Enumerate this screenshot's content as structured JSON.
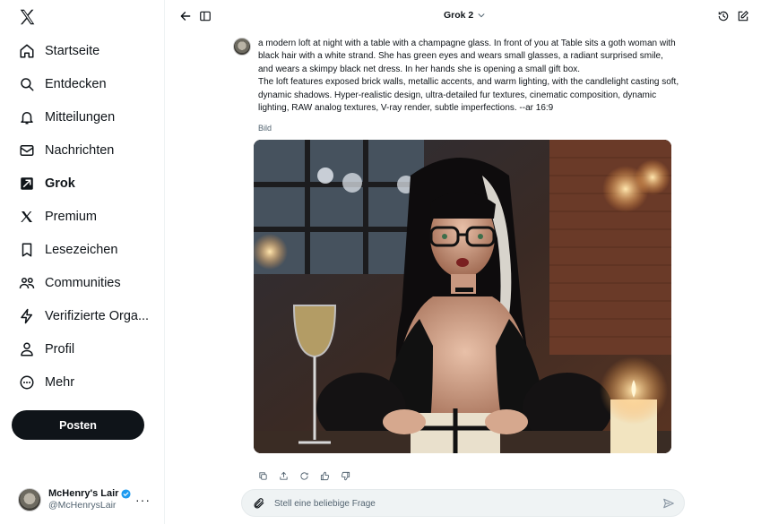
{
  "sidebar": {
    "logo_icon": "x-logo-icon",
    "items": [
      {
        "label": "Startseite",
        "icon": "home-icon"
      },
      {
        "label": "Entdecken",
        "icon": "search-icon"
      },
      {
        "label": "Mitteilungen",
        "icon": "bell-icon"
      },
      {
        "label": "Nachrichten",
        "icon": "mail-icon"
      },
      {
        "label": "Grok",
        "icon": "grok-icon",
        "active": true
      },
      {
        "label": "Premium",
        "icon": "x-premium-icon"
      },
      {
        "label": "Lesezeichen",
        "icon": "bookmark-icon"
      },
      {
        "label": "Communities",
        "icon": "people-icon"
      },
      {
        "label": "Verifizierte Orga...",
        "icon": "lightning-icon"
      },
      {
        "label": "Profil",
        "icon": "person-icon"
      },
      {
        "label": "Mehr",
        "icon": "more-circle-icon"
      }
    ],
    "post_label": "Posten"
  },
  "account": {
    "name": "McHenry's Lair",
    "handle": "@McHenrysLair",
    "verified_color": "#1d9bf0",
    "more": "···"
  },
  "topbar": {
    "model": "Grok 2"
  },
  "chat": {
    "prompt_line1": "a modern loft at night with a table with a champagne glass. In front of you at Table sits a goth woman with black hair with a white strand. She has green eyes and wears small glasses, a radiant surprised smile, and wears a skimpy  black  net dress. In her hands she is  opening a  small gift box.",
    "prompt_line2": "The loft features exposed brick walls, metallic accents, and warm lighting, with the candlelight casting soft, dynamic shadows. Hyper-realistic design, ultra-detailed fur textures, cinematic composition, dynamic lighting, RAW analog textures, V-ray render, subtle imperfections. --ar 16:9",
    "image_label": "Bild"
  },
  "composer": {
    "placeholder": "Stell eine beliebige Frage"
  },
  "colors": {
    "accent": "#0f1419",
    "muted": "#536471",
    "composer_bg": "#eff3f4"
  }
}
